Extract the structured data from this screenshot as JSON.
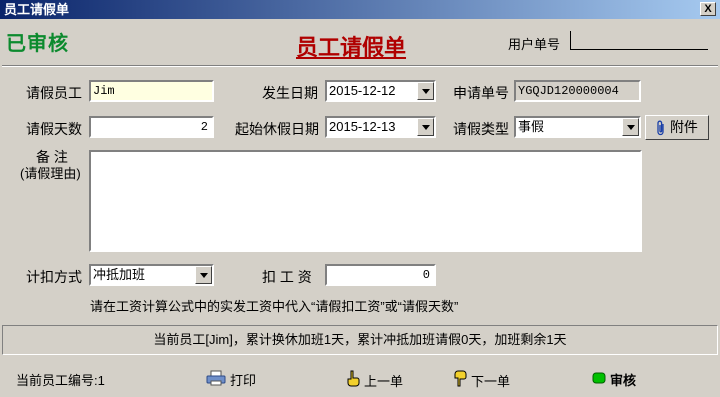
{
  "window": {
    "title": "员工请假单",
    "close_label": "X"
  },
  "header": {
    "stamp": "已审核",
    "form_title": "员工请假单",
    "user_no_label": "用户单号"
  },
  "fields": {
    "employee": {
      "label": "请假员工",
      "value": "Jim"
    },
    "days": {
      "label": "请假天数",
      "value": "2"
    },
    "occur_date": {
      "label": "发生日期",
      "value": "2015-12-12"
    },
    "start_date": {
      "label": "起始休假日期",
      "value": "2015-12-13"
    },
    "apply_no": {
      "label": "申请单号",
      "value": "YGQJD120000004"
    },
    "leave_type": {
      "label": "请假类型",
      "value": "事假"
    },
    "remark": {
      "label_line1": "备    注",
      "label_line2": "(请假理由)",
      "value": ""
    },
    "deduct_method": {
      "label": "计扣方式",
      "value": "冲抵加班"
    },
    "deduct_pay": {
      "label": "扣 工 资",
      "value": "0"
    }
  },
  "buttons": {
    "attach": "附件",
    "print": "打印",
    "prev": "上一单",
    "next": "下一单",
    "audit": "审核"
  },
  "hint": "请在工资计算公式中的实发工资中代入“请假扣工资”或“请假天数”",
  "status": "当前员工[Jim]，累计换休加班1天，累计冲抵加班请假0天，加班剩余1天",
  "footer": {
    "current_employee_no": "当前员工编号:1"
  },
  "colors": {
    "stamp": "#0c8a2e",
    "title": "#b00000",
    "audit_indicator": "#00c000"
  }
}
